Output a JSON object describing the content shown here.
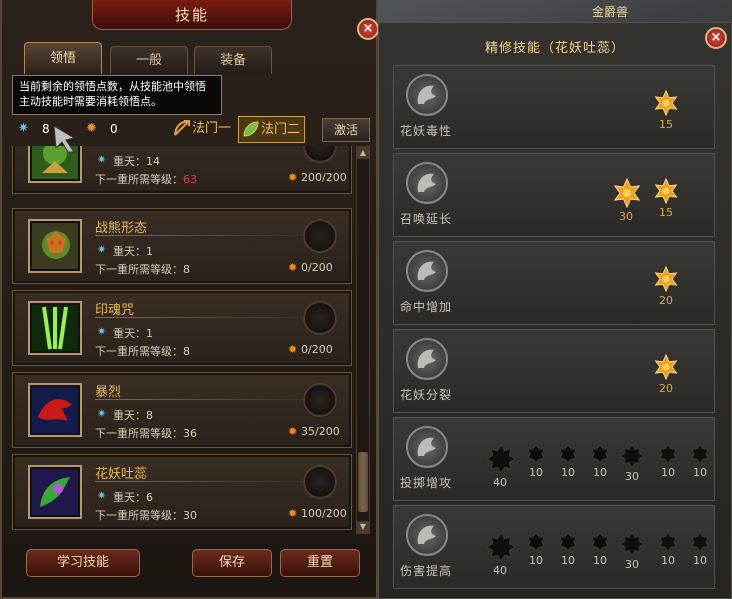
{
  "background": {
    "name": "金爵兽"
  },
  "left_panel": {
    "title": "技能",
    "close": "×",
    "tabs": [
      {
        "label": "领悟",
        "active": true
      },
      {
        "label": "一般",
        "active": false
      },
      {
        "label": "装备",
        "active": false
      }
    ],
    "tooltip": "当前剩余的领悟点数，从技能池中领悟主动技能时需要消耗领悟点。",
    "points": {
      "blue": "8",
      "orange": "0"
    },
    "factions": [
      "法门一",
      "法门二"
    ],
    "activate_label": "激活",
    "skills": [
      {
        "name": "",
        "rank_label": "重天：",
        "rank": "14",
        "req_label": "下一重所需等级：",
        "req": "63",
        "req_red": true,
        "cost": "200/200"
      },
      {
        "name": "战熊形态",
        "rank_label": "重天：",
        "rank": "1",
        "req_label": "下一重所需等级：",
        "req": "8",
        "req_red": false,
        "cost": "0/200"
      },
      {
        "name": "印魂咒",
        "rank_label": "重天：",
        "rank": "1",
        "req_label": "下一重所需等级：",
        "req": "8",
        "req_red": false,
        "cost": "0/200"
      },
      {
        "name": "暴烈",
        "rank_label": "重天：",
        "rank": "8",
        "req_label": "下一重所需等级：",
        "req": "36",
        "req_red": false,
        "cost": "35/200"
      },
      {
        "name": "花妖吐蕊",
        "rank_label": "重天：",
        "rank": "6",
        "req_label": "下一重所需等级：",
        "req": "30",
        "req_red": false,
        "cost": "100/200"
      }
    ],
    "buttons": {
      "learn": "学习技能",
      "save": "保存",
      "reset": "重置"
    }
  },
  "right_panel": {
    "title": "精修技能（花妖吐蕊）",
    "close": "×",
    "rows": [
      {
        "name": "花妖毒性",
        "nodes": [
          {
            "value": "15",
            "type": "gold"
          }
        ]
      },
      {
        "name": "召唤延长",
        "nodes": [
          {
            "value": "30",
            "type": "gold-big"
          },
          {
            "value": "15",
            "type": "gold"
          }
        ]
      },
      {
        "name": "命中增加",
        "nodes": [
          {
            "value": "20",
            "type": "gold"
          }
        ]
      },
      {
        "name": "花妖分裂",
        "nodes": [
          {
            "value": "20",
            "type": "gold"
          }
        ]
      },
      {
        "name": "投掷增攻",
        "nodes": [
          {
            "value": "40",
            "type": "dark-big"
          },
          {
            "value": "10",
            "type": "dark"
          },
          {
            "value": "10",
            "type": "dark"
          },
          {
            "value": "10",
            "type": "dark"
          },
          {
            "value": "30",
            "type": "dark-star"
          },
          {
            "value": "10",
            "type": "dark"
          },
          {
            "value": "10",
            "type": "dark"
          }
        ]
      },
      {
        "name": "伤害提高",
        "nodes": [
          {
            "value": "40",
            "type": "dark-big"
          },
          {
            "value": "10",
            "type": "dark"
          },
          {
            "value": "10",
            "type": "dark"
          },
          {
            "value": "10",
            "type": "dark"
          },
          {
            "value": "30",
            "type": "dark-star"
          },
          {
            "value": "10",
            "type": "dark"
          },
          {
            "value": "10",
            "type": "dark"
          }
        ]
      }
    ]
  },
  "colors": {
    "accent": "#e8b860",
    "cost_icon": "#f08820",
    "rank_icon": "#5ec8f0",
    "warning": "#e04040"
  }
}
